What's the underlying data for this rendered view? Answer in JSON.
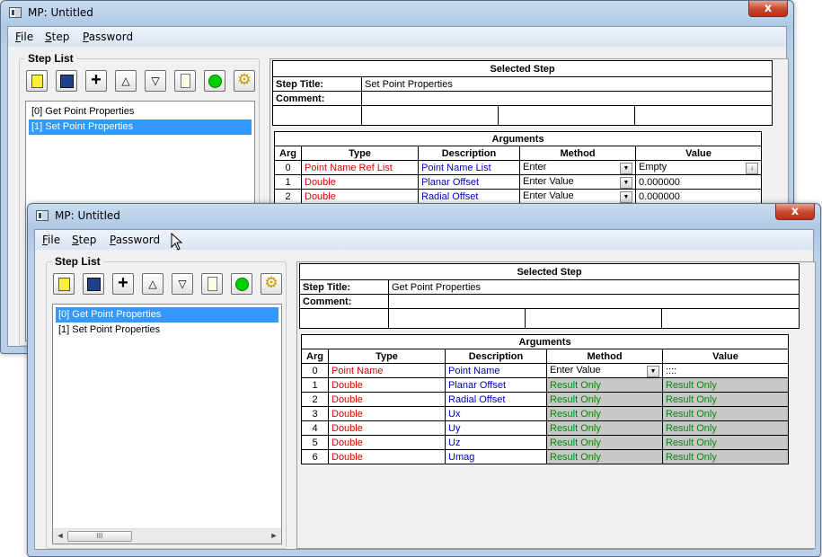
{
  "back_window": {
    "title": "MP: Untitled",
    "close_label": "x",
    "menu": [
      {
        "mnemonic": "F",
        "rest": "ile"
      },
      {
        "mnemonic": "S",
        "rest": "tep"
      },
      {
        "mnemonic": "P",
        "rest": "assword"
      }
    ],
    "step_list_label": "Step List",
    "steps": [
      "[0] Get Point Properties",
      "[1] Set Point Properties"
    ],
    "selected_step_index": 1,
    "selected_step_header": "Selected Step",
    "step_title_label": "Step Title:",
    "step_title_value": "Set Point Properties",
    "comment_label": "Comment:",
    "arguments_header": "Arguments",
    "columns": [
      "Arg",
      "Type",
      "Description",
      "Method",
      "Value"
    ],
    "rows": [
      {
        "arg": "0",
        "type": "Point Name Ref List",
        "description": "Point Name List",
        "method": "Enter",
        "value": "Empty"
      },
      {
        "arg": "1",
        "type": "Double",
        "description": "Planar Offset",
        "method": "Enter Value",
        "value": "0.000000"
      },
      {
        "arg": "2",
        "type": "Double",
        "description": "Radial Offset",
        "method": "Enter Value",
        "value": "0.000000"
      }
    ]
  },
  "front_window": {
    "title": "MP: Untitled",
    "close_label": "x",
    "menu": [
      {
        "mnemonic": "F",
        "rest": "ile"
      },
      {
        "mnemonic": "S",
        "rest": "tep"
      },
      {
        "mnemonic": "P",
        "rest": "assword"
      }
    ],
    "step_list_label": "Step List",
    "steps": [
      "[0] Get Point Properties",
      "[1] Set Point Properties"
    ],
    "selected_step_index": 0,
    "scroll_thumb_label": "III",
    "selected_step_header": "Selected Step",
    "step_title_label": "Step Title:",
    "step_title_value": "Get Point Properties",
    "comment_label": "Comment:",
    "arguments_header": "Arguments",
    "columns": [
      "Arg",
      "Type",
      "Description",
      "Method",
      "Value"
    ],
    "rows": [
      {
        "arg": "0",
        "type": "Point Name",
        "description": "Point Name",
        "method": "Enter Value",
        "value": "::::",
        "editable": true
      },
      {
        "arg": "1",
        "type": "Double",
        "description": "Planar Offset",
        "method": "Result Only",
        "value": "Result Only"
      },
      {
        "arg": "2",
        "type": "Double",
        "description": "Radial Offset",
        "method": "Result Only",
        "value": "Result Only"
      },
      {
        "arg": "3",
        "type": "Double",
        "description": "Ux",
        "method": "Result Only",
        "value": "Result Only"
      },
      {
        "arg": "4",
        "type": "Double",
        "description": "Uy",
        "method": "Result Only",
        "value": "Result Only"
      },
      {
        "arg": "5",
        "type": "Double",
        "description": "Uz",
        "method": "Result Only",
        "value": "Result Only"
      },
      {
        "arg": "6",
        "type": "Double",
        "description": "Umag",
        "method": "Result Only",
        "value": "Result Only"
      }
    ]
  },
  "toolbar_icons": [
    "notes-icon",
    "save-icon",
    "add-icon",
    "move-up-icon",
    "move-down-icon",
    "document-icon",
    "run-icon",
    "settings-icon"
  ],
  "colors": {
    "type_text": "#e00000",
    "description_text": "#0000c0",
    "result_text": "#008a00",
    "selection": "#3399ff",
    "close_button": "#c9442a"
  }
}
